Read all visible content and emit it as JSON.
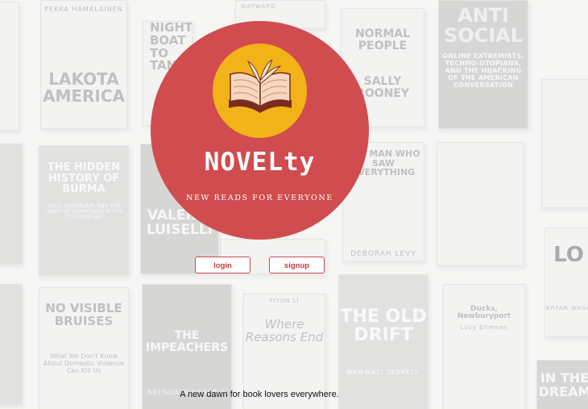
{
  "brand": {
    "name": "NOVELty",
    "tagline": "NEW READS FOR EVERYONE",
    "logo_icon": "open-book-icon"
  },
  "actions": {
    "login_label": "login",
    "signup_label": "signup"
  },
  "footer": {
    "text": "A new dawn for book lovers everywhere."
  },
  "background_books": [
    {
      "title": "PEKKA HÄMÄLÄINEN",
      "subtitle": "LAKOTA AMERICA"
    },
    {
      "title": "NIGHT BOAT TO TANGIER",
      "subtitle": ""
    },
    {
      "title": "WAYWARD",
      "subtitle": ""
    },
    {
      "title": "NORMAL PEOPLE",
      "subtitle": "SALLY ROONEY"
    },
    {
      "title": "ANTI SOCIAL",
      "subtitle": "ONLINE EXTREMISTS, TECHNO-UTOPIANS, AND THE HIJACKING OF THE AMERICAN CONVERSATION"
    },
    {
      "title": "THE HIDDEN HISTORY OF BURMA",
      "subtitle": "RACE, CAPITALISM, AND THE CRISIS OF DEMOCRACY IN THE 21ST CENTURY"
    },
    {
      "title": "VALERIA LUISELLI",
      "subtitle": ""
    },
    {
      "title": "THE MAN WHO SAW EVERYTHING",
      "subtitle": "DEBORAH LEVY"
    },
    {
      "title": "NO VISIBLE BRUISES",
      "subtitle": "What We Don't Know About Domestic Violence Can Kill Us"
    },
    {
      "title": "THE IMPEACHERS",
      "subtitle": "BRENDA WINEAPPLE"
    },
    {
      "title": "Where Reasons End",
      "subtitle": "YIYUN LI"
    },
    {
      "title": "THE OLD DRIFT",
      "subtitle": "NAMWALI SERPELL"
    },
    {
      "title": "Ducks, Newburyport",
      "subtitle": "Lucy Ellmann"
    },
    {
      "title": "IN THE DREAM",
      "subtitle": ""
    },
    {
      "title": "LO",
      "subtitle": "BRYAN WASH"
    }
  ],
  "colors": {
    "circle": "#d14c4f",
    "logo_disc": "#f2b318",
    "button_accent": "#cf4a4d"
  }
}
